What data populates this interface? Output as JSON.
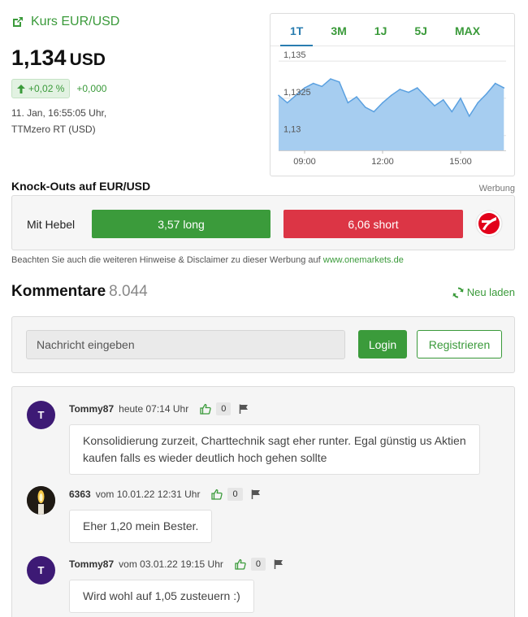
{
  "quote": {
    "title": "Kurs EUR/USD",
    "price": "1,134",
    "currency": "USD",
    "change_pct": "+0,02 %",
    "change_abs": "+0,000",
    "timestamp": "11. Jan, 16:55:05 Uhr,",
    "source": "TTMzero RT (USD)"
  },
  "chart": {
    "tabs": [
      "1T",
      "3M",
      "1J",
      "5J",
      "MAX"
    ],
    "active_tab": "1T",
    "y_labels": [
      "1,135",
      "1,1325",
      "1,13"
    ],
    "x_labels": [
      "09:00",
      "12:00",
      "15:00"
    ],
    "fill_color": "#a6cdf0",
    "line_color": "#5aa0e0"
  },
  "chart_data": {
    "type": "area",
    "x": [
      "08:00",
      "08:20",
      "08:40",
      "09:00",
      "09:20",
      "09:40",
      "10:00",
      "10:20",
      "10:40",
      "11:00",
      "11:20",
      "11:40",
      "12:00",
      "12:20",
      "12:40",
      "13:00",
      "13:20",
      "13:40",
      "14:00",
      "14:20",
      "14:40",
      "15:00",
      "15:20",
      "15:40",
      "16:00",
      "16:20",
      "16:40"
    ],
    "y": [
      1.1327,
      1.1322,
      1.1327,
      1.1332,
      1.1335,
      1.1333,
      1.1338,
      1.1336,
      1.1322,
      1.1326,
      1.1319,
      1.1316,
      1.1322,
      1.1327,
      1.1331,
      1.1329,
      1.1332,
      1.1326,
      1.132,
      1.1324,
      1.1316,
      1.1325,
      1.1313,
      1.1322,
      1.1328,
      1.1335,
      1.1332
    ],
    "xlabel": "",
    "ylabel": "",
    "ylim": [
      1.129,
      1.1355
    ],
    "grid": true
  },
  "knockouts": {
    "title": "Knock-Outs auf EUR/USD",
    "ad_label": "Werbung",
    "hebel_label": "Mit Hebel",
    "long_label": "3,57 long",
    "short_label": "6,06 short",
    "disclaimer_text": "Beachten Sie auch die weiteren Hinweise & Disclaimer zu dieser Werbung auf ",
    "disclaimer_link": "www.onemarkets.de"
  },
  "comments_header": {
    "title": "Kommentare",
    "count": "8.044",
    "reload_label": "Neu laden"
  },
  "input": {
    "placeholder": "Nachricht eingeben",
    "login_label": "Login",
    "register_label": "Registrieren"
  },
  "comments": [
    {
      "avatar": "T",
      "user": "Tommy87",
      "time": "heute 07:14 Uhr",
      "likes": "0",
      "lines": [
        "Konsolidierung zurzeit, Charttechnik sagt eher runter. Egal günstig us Aktien",
        "kaufen falls es wieder deutlich hoch gehen sollte"
      ]
    },
    {
      "avatar": "",
      "user": "6363",
      "time": "vom 10.01.22 12:31 Uhr",
      "likes": "0",
      "lines": [
        "Eher 1,20 mein Bester."
      ]
    },
    {
      "avatar": "T",
      "user": "Tommy87",
      "time": "vom 03.01.22 19:15 Uhr",
      "likes": "0",
      "lines": [
        "Wird wohl auf 1,05 zusteuern :)"
      ]
    }
  ]
}
